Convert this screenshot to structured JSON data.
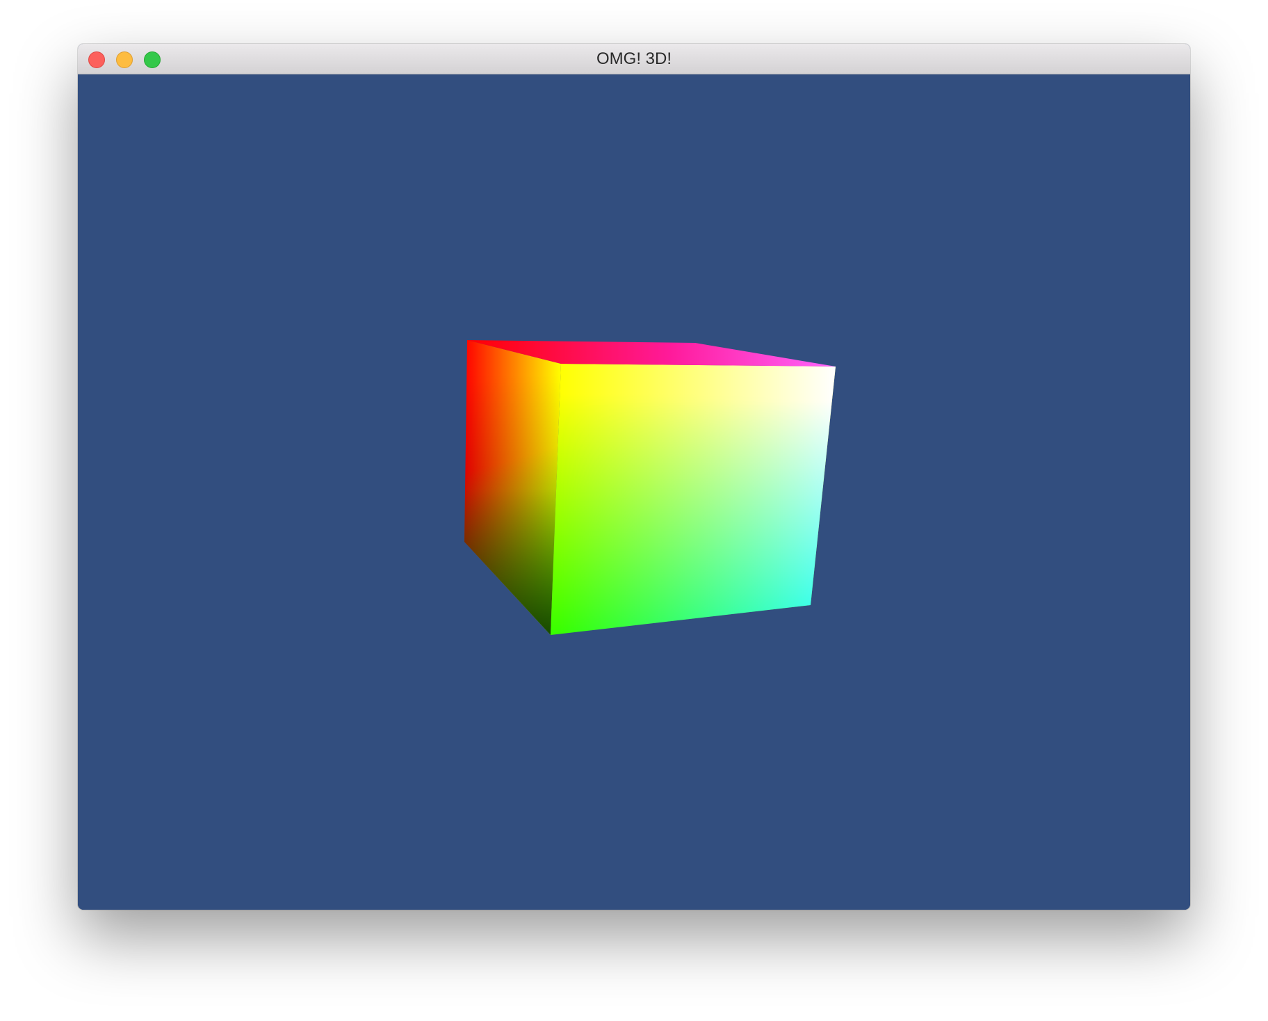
{
  "window": {
    "title": "OMG! 3D!",
    "controls": {
      "close": "close",
      "minimize": "minimize",
      "zoom": "zoom"
    }
  },
  "scene": {
    "background_color": "#324e7f",
    "object": "color-cube",
    "vertex_colors": [
      "#ff0000",
      "#ffff00",
      "#ff00ff",
      "#ffffff",
      "#000000",
      "#00ff00",
      "#00ffff"
    ]
  }
}
